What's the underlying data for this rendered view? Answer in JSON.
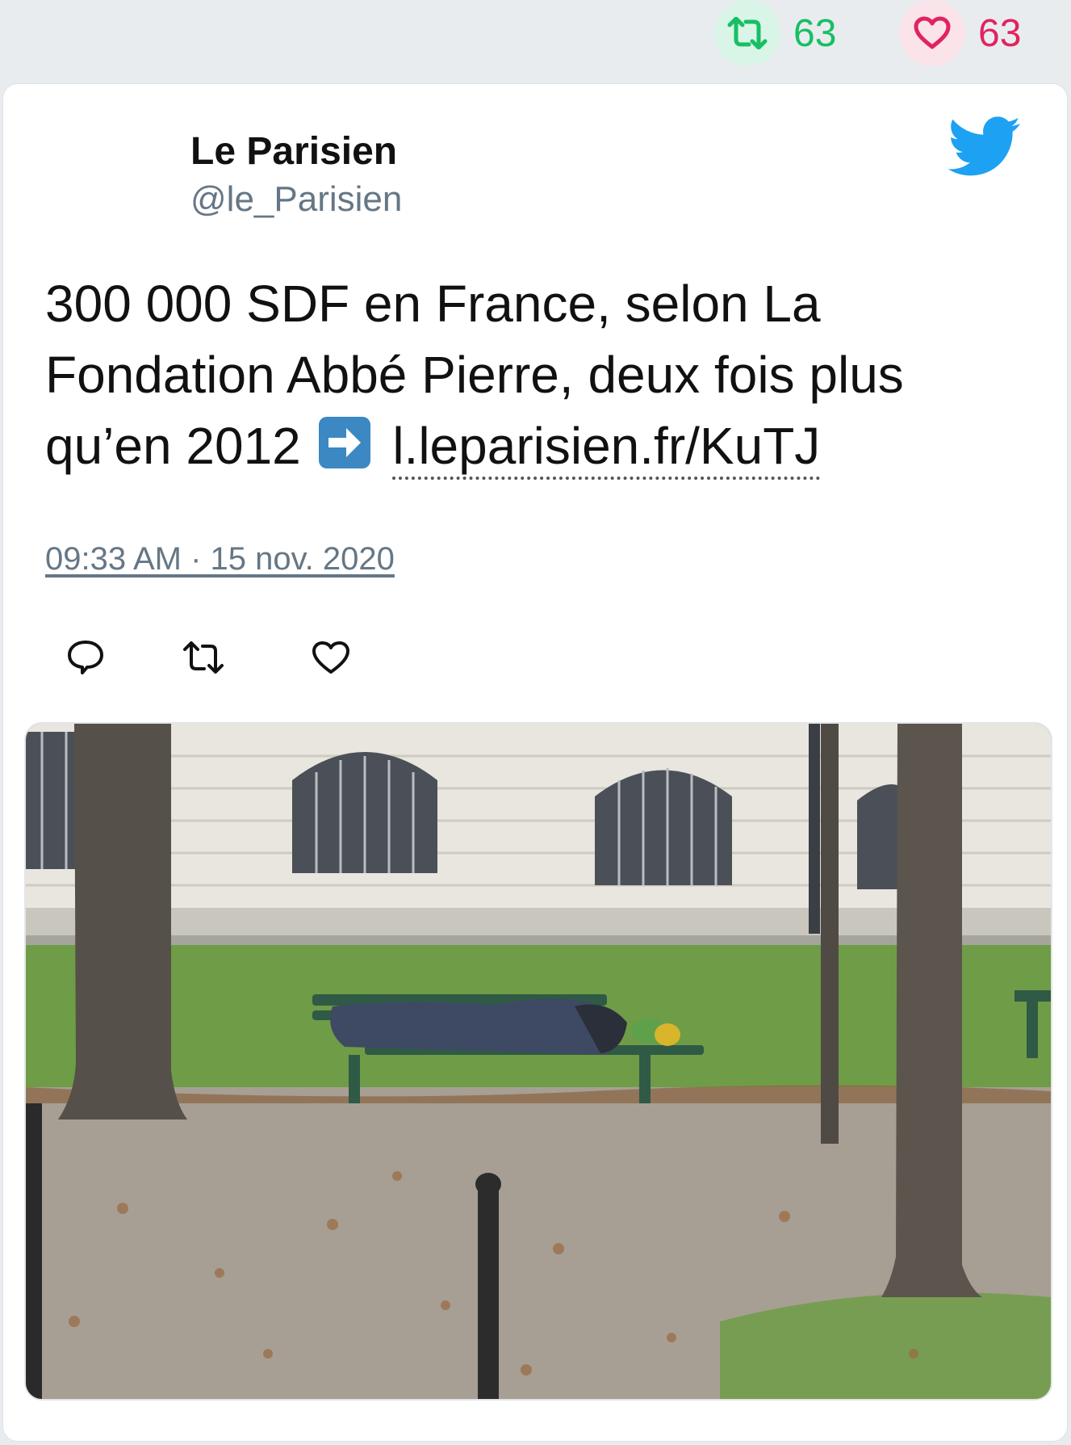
{
  "stats": {
    "retweet_count": "63",
    "like_count": "63"
  },
  "tweet": {
    "author_name": "Le Parisien",
    "author_handle": "@le_Parisien",
    "text_main": "300 000 SDF en France, selon La Fondation Abbé Pierre, deux fois plus qu’en 2012",
    "link_text": "l.leparisien.fr/KuTJ",
    "timestamp": "09:33 AM · 15 nov. 2020"
  },
  "icons": {
    "retweet": "retweet-icon",
    "like": "heart-icon",
    "twitter": "twitter-bird-icon",
    "reply": "reply-icon",
    "arrow_emoji": "right-arrow-emoji-icon"
  },
  "photo": {
    "description_name": "homeless-person-on-bench-photo"
  },
  "colors": {
    "retweet_green": "#17bf63",
    "like_red": "#e0245e",
    "twitter_blue": "#1da1f2",
    "muted_text": "#657786"
  }
}
